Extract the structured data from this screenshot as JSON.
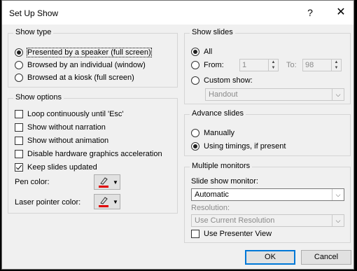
{
  "dialog": {
    "title": "Set Up Show",
    "help_icon": "?",
    "close_icon": "✕"
  },
  "show_type": {
    "title": "Show type",
    "options": [
      {
        "label": "Presented by a speaker (full screen)",
        "selected": true
      },
      {
        "label": "Browsed by an individual (window)",
        "selected": false
      },
      {
        "label": "Browsed at a kiosk (full screen)",
        "selected": false
      }
    ]
  },
  "show_options": {
    "title": "Show options",
    "checks": [
      {
        "label": "Loop continuously until 'Esc'",
        "checked": false
      },
      {
        "label": "Show without narration",
        "checked": false
      },
      {
        "label": "Show without animation",
        "checked": false
      },
      {
        "label": "Disable hardware graphics acceleration",
        "checked": false
      },
      {
        "label": "Keep slides updated",
        "checked": true
      }
    ],
    "pen_color_label": "Pen color:",
    "laser_color_label": "Laser pointer color:",
    "pen_color": "#e00000",
    "laser_color": "#e00000"
  },
  "show_slides": {
    "title": "Show slides",
    "all_label": "All",
    "from_label": "From:",
    "from_value": "1",
    "to_label": "To:",
    "to_value": "98",
    "custom_label": "Custom show:",
    "custom_value": "Handout",
    "selected": "all"
  },
  "advance_slides": {
    "title": "Advance slides",
    "manual_label": "Manually",
    "timings_label": "Using timings, if present",
    "selected": "timings"
  },
  "monitors": {
    "title": "Multiple monitors",
    "monitor_label": "Slide show monitor:",
    "monitor_value": "Automatic",
    "resolution_label": "Resolution:",
    "resolution_value": "Use Current Resolution",
    "presenter_label": "Use Presenter View",
    "presenter_checked": false
  },
  "buttons": {
    "ok": "OK",
    "cancel": "Cancel"
  }
}
